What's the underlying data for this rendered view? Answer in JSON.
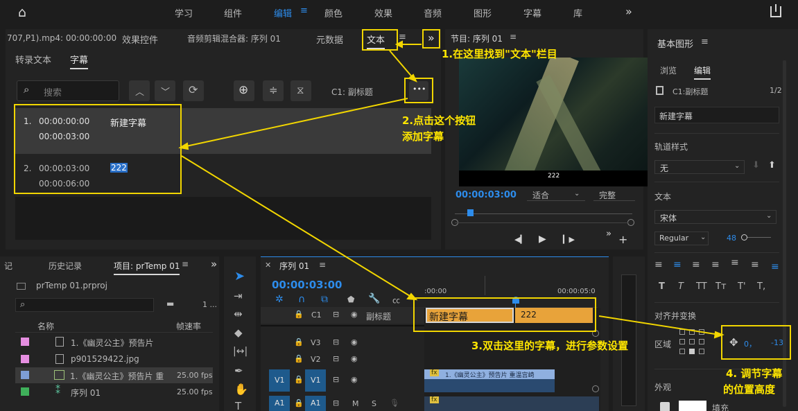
{
  "topbar": {
    "workspaces": [
      "学习",
      "组件",
      "编辑",
      "颜色",
      "效果",
      "音频",
      "图形",
      "字幕",
      "库"
    ],
    "active": "编辑",
    "more": "»"
  },
  "left_panel": {
    "tabs": [
      "707,P1).mp4: 00:00:00:00",
      "效果控件",
      "音频剪辑混合器: 序列 01",
      "元数据",
      "文本"
    ],
    "menu_glyph": "≡",
    "overflow": "»",
    "subtabs": [
      "转录文本",
      "字幕"
    ],
    "search_placeholder": "搜索",
    "track_label": "C1: 副标题",
    "more_glyph": "•••",
    "captions": [
      {
        "num": "1.",
        "in": "00:00:00:00",
        "out": "00:00:03:00",
        "text": "新建字幕"
      },
      {
        "num": "2.",
        "in": "00:00:03:00",
        "out": "00:00:06:00",
        "text": "222"
      }
    ]
  },
  "program": {
    "title": "节目: 序列 01",
    "menu_glyph": "≡",
    "caption_overlay": "222",
    "timecode": "00:00:03:00",
    "fit": "适合",
    "quality": "完整",
    "controls": [
      "◀▎",
      "▶",
      "▎▶",
      "»",
      "+"
    ]
  },
  "essential_graphics": {
    "title": "基本图形",
    "menu_glyph": "≡",
    "tabs": [
      "浏览",
      "编辑"
    ],
    "track": "C1:副标题",
    "page": "1/2",
    "item": "新建字幕",
    "track_style_label": "轨道样式",
    "track_style_value": "无",
    "text_label": "文本",
    "font": "宋体",
    "font_style": "Regular",
    "font_size": "48",
    "align_label": "对齐并变换",
    "region_label": "区域",
    "pos_x": "0，",
    "pos_y": "-13",
    "appearance_label": "外观",
    "fill_label": "填充",
    "type_buttons": [
      "T",
      "T",
      "TT",
      "Tт",
      "T'",
      "T,"
    ]
  },
  "project": {
    "tabs": [
      "记",
      "历史记录",
      "项目: prTemp 01"
    ],
    "menu_glyph": "≡",
    "overflow": "»",
    "file": "prTemp 01.prproj",
    "col_name": "名称",
    "col_fps": "帧速率",
    "count": "1 ...",
    "items": [
      {
        "name": "1.《幽灵公主》预告片",
        "fps": "",
        "color": "#e58ee0"
      },
      {
        "name": "p901529422.jpg",
        "fps": "",
        "color": "#e58ee0"
      },
      {
        "name": "1.《幽灵公主》预告片 重",
        "fps": "25.00 fps",
        "color": "#7d9ed6"
      },
      {
        "name": "序列 01",
        "fps": "25.00 fps",
        "color": "#3fb05a"
      }
    ]
  },
  "timeline": {
    "title": "序列 01",
    "menu_glyph": "≡",
    "timecode": "00:00:03:00",
    "ruler": [
      ":00:00",
      "00:00:05:0"
    ],
    "caption_track": "副标题",
    "tracks": [
      "C1",
      "V3",
      "V2",
      "V1",
      "A1"
    ],
    "clips": {
      "cap1": "新建字幕",
      "cap2": "222",
      "video": "1.《幽灵公主》预告片 重温宫崎",
      "fx": "fx"
    }
  },
  "annotations": {
    "step1": "1.在这里找到\"文本\"栏目",
    "step2a": "2.点击这个按钮",
    "step2b": "添加字幕",
    "step3": "3.双击这里的字幕，进行参数设置",
    "step4a": "4. 调节字幕",
    "step4b": "的位置高度"
  },
  "colors": {
    "accent_blue": "#2d8ceb",
    "annotation_yellow": "#f2d600",
    "caption_clip": "#e8a33a",
    "video_clip": "#8fb0e0"
  }
}
